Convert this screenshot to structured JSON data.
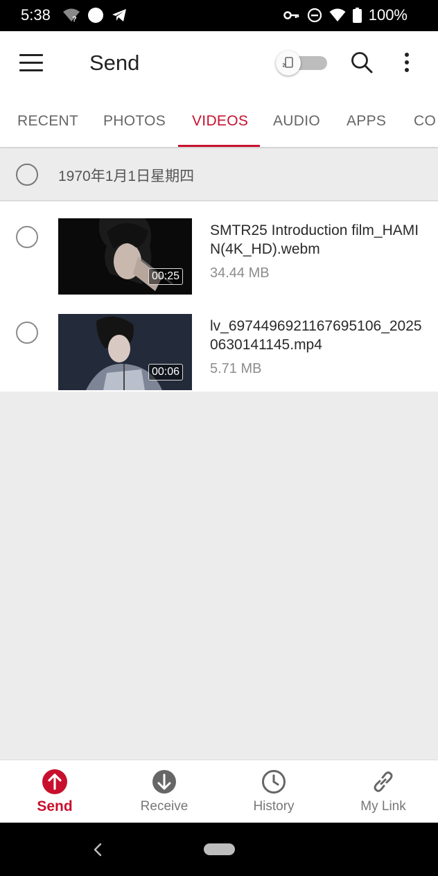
{
  "status_bar": {
    "time": "5:38",
    "battery_text": "100%",
    "icons": [
      "wifi-question-icon",
      "circle-icon",
      "telegram-icon",
      "vpn-key-icon",
      "do-not-disturb-icon",
      "wifi-icon",
      "battery-icon"
    ]
  },
  "app_bar": {
    "title": "Send",
    "icons": [
      "menu-icon",
      "cast-toggle",
      "search-icon",
      "more-vert-icon"
    ]
  },
  "tabs": [
    {
      "label": "RECENT"
    },
    {
      "label": "PHOTOS"
    },
    {
      "label": "VIDEOS",
      "active": true
    },
    {
      "label": "AUDIO"
    },
    {
      "label": "APPS"
    },
    {
      "label": "CO"
    }
  ],
  "date_group": {
    "label": "1970年1月1日星期四"
  },
  "files": [
    {
      "name": "SMTR25 Introduction film_HAMIN(4K_HD).webm",
      "size": "34.44 MB",
      "duration": "00:25"
    },
    {
      "name": "lv_6974496921167695106_20250630141145.mp4",
      "size": "5.71 MB",
      "duration": "00:06"
    }
  ],
  "bottom_nav": [
    {
      "label": "Send",
      "icon": "send-up-arrow-icon",
      "active": true
    },
    {
      "label": "Receive",
      "icon": "receive-down-arrow-icon"
    },
    {
      "label": "History",
      "icon": "clock-icon"
    },
    {
      "label": "My Link",
      "icon": "link-icon"
    }
  ],
  "colors": {
    "accent": "#c8102e",
    "background": "#ececec"
  }
}
